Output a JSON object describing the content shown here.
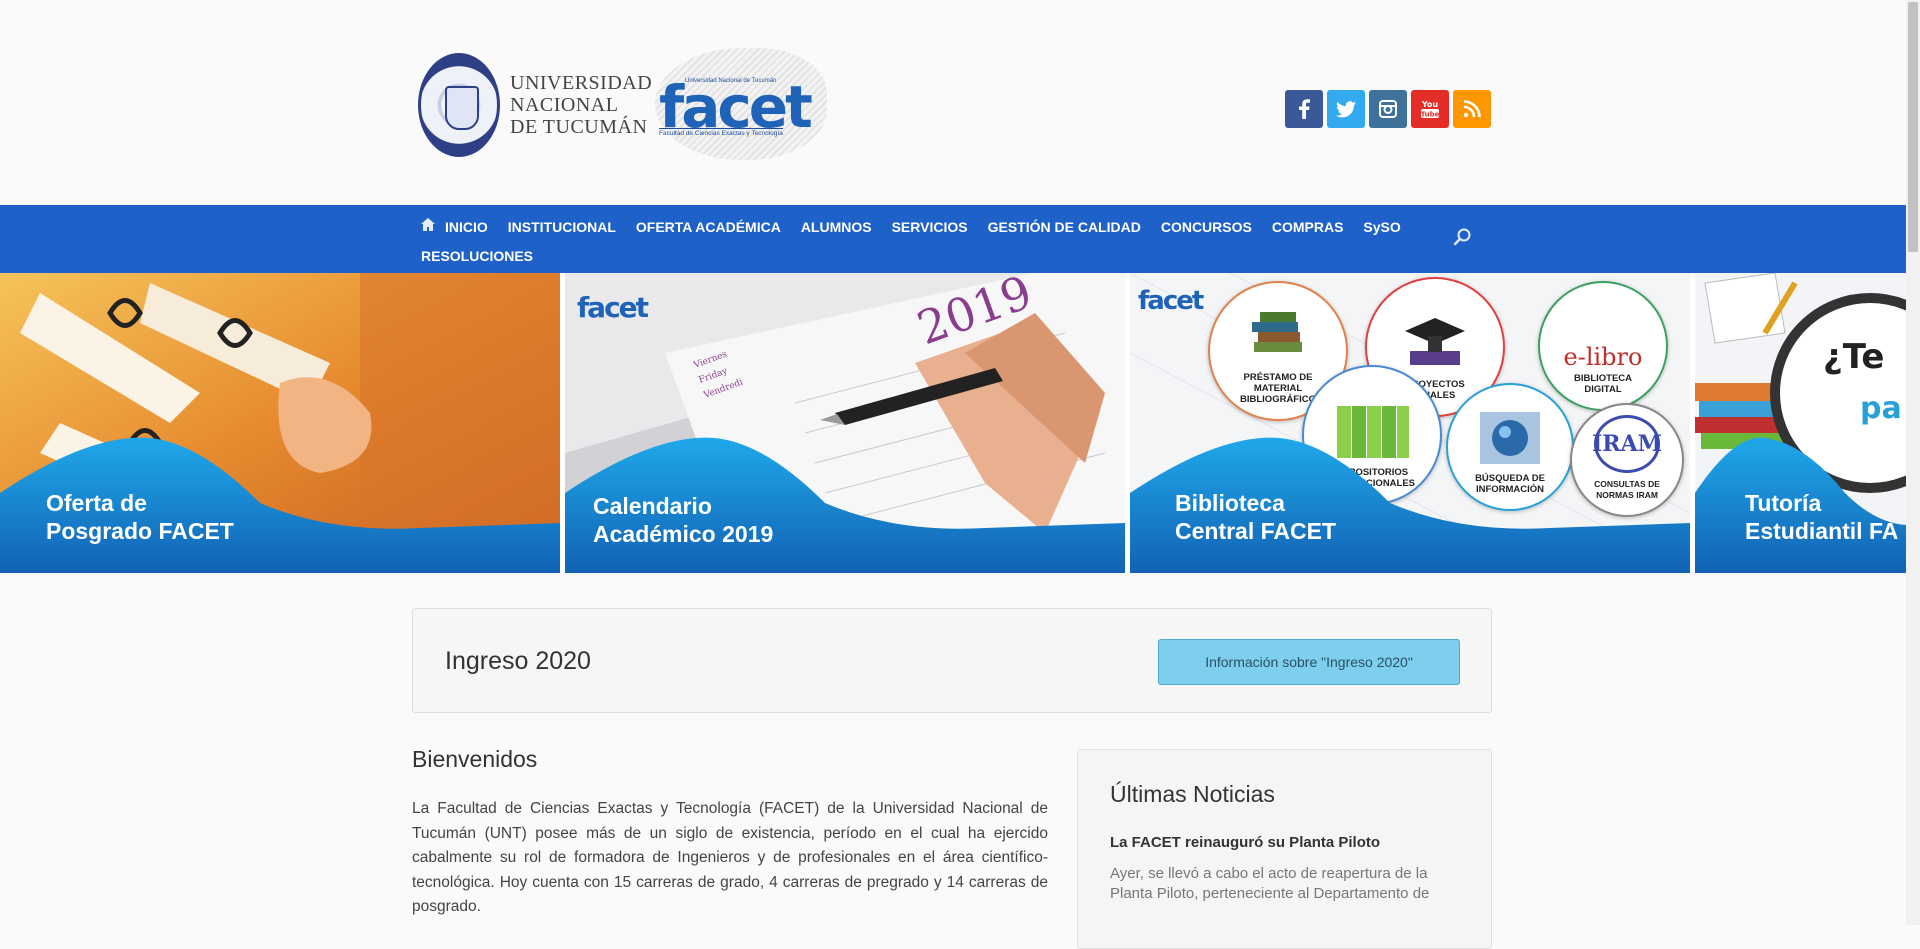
{
  "header": {
    "unt_name_lines": [
      "UNIVERSIDAD",
      "NACIONAL",
      "DE TUCUMÁN"
    ],
    "facet_logo": {
      "top_text": "Universidad Nacional de Tucumán",
      "wordmark": "facet",
      "bottom_text": "Facultad de Ciencias Exactas y Tecnología"
    },
    "social": [
      {
        "name": "facebook-icon",
        "glyph": "f",
        "color": "#3b5998"
      },
      {
        "name": "twitter-icon",
        "glyph": "",
        "color": "#33aaf0"
      },
      {
        "name": "instagram-icon",
        "glyph": "",
        "color": "#3f729b"
      },
      {
        "name": "youtube-icon",
        "glyph": "You Tube",
        "color": "#e52d27"
      },
      {
        "name": "rss-icon",
        "glyph": "",
        "color": "#ff9800"
      }
    ]
  },
  "nav": {
    "items": [
      "INICIO",
      "INSTITUCIONAL",
      "OFERTA ACADÉMICA",
      "ALUMNOS",
      "SERVICIOS",
      "GESTIÓN DE CALIDAD",
      "CONCURSOS",
      "COMPRAS",
      "SySO"
    ],
    "second_row": [
      "RESOLUCIONES"
    ],
    "background": "#1e61c8"
  },
  "slider": {
    "slides": [
      {
        "caption_lines": [
          "Oferta de",
          "Posgrado FACET"
        ]
      },
      {
        "caption_lines": [
          "Calendario",
          "Académico 2019"
        ],
        "year": "2019",
        "days": [
          "Viernes",
          "Friday",
          "Vendredi"
        ],
        "logo": "facet"
      },
      {
        "caption_lines": [
          "Biblioteca",
          "Central FACET"
        ],
        "logo": "facet",
        "bubbles": [
          {
            "label": "PRÉSTAMO DE MATERIAL BIBLIOGRÁFICO"
          },
          {
            "label": "PROYECTOS FINALES"
          },
          {
            "label": "BIBLIOTECA DIGITAL",
            "brand": "e-libro"
          },
          {
            "label": "REPOSITORIOS INSTITUCIONALES"
          },
          {
            "label": "BÚSQUEDA DE INFORMACIÓN"
          },
          {
            "label": "CONSULTAS DE NORMAS IRAM",
            "brand": "IRAM"
          }
        ]
      },
      {
        "caption_lines": [
          "Tutoría",
          "Estudiantil FA"
        ],
        "partial_text": [
          "¿Te",
          "pa"
        ]
      }
    ]
  },
  "ingreso": {
    "title": "Ingreso 2020",
    "button_label": "Información sobre \"Ingreso 2020\""
  },
  "welcome": {
    "title": "Bienvenidos",
    "text": "La Facultad de Ciencias Exactas y Tecnología (FACET) de la Universidad Nacional de Tucumán (UNT) posee más de un siglo de existencia, período en el cual ha ejercido cabalmente su rol de formadora de Ingenieros y de profesionales en el área científico-tecnológica. Hoy cuenta con 15 carreras de grado, 4 carreras de pregrado y 14 carreras de posgrado."
  },
  "news": {
    "title": "Últimas Noticias",
    "items": [
      {
        "title": "La FACET reinauguró su Planta Piloto",
        "excerpt": "Ayer, se llevó a cabo el acto de reapertura de la Planta Piloto, perteneciente al Departamento de"
      }
    ]
  }
}
